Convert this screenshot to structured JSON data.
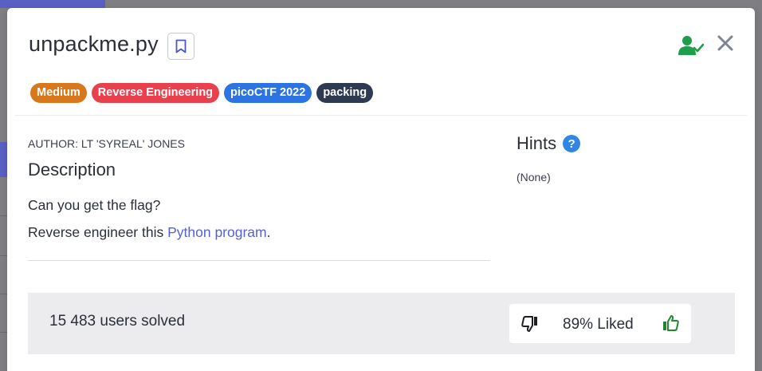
{
  "challenge": {
    "title": "unpackme.py",
    "tags": [
      {
        "label": "Medium",
        "color": "#d9771d"
      },
      {
        "label": "Reverse Engineering",
        "color": "#e8404c"
      },
      {
        "label": "picoCTF 2022",
        "color": "#2b74e2"
      },
      {
        "label": "packing",
        "color": "#2e3a52"
      }
    ],
    "author": "AUTHOR: LT 'SYREAL' JONES",
    "description_heading": "Description",
    "description_line1": "Can you get the flag?",
    "description_line2_prefix": "Reverse engineer this ",
    "description_link": "Python program",
    "description_line2_suffix": ".",
    "hints_heading": "Hints",
    "hints_help": "?",
    "hints_value": "(None)",
    "solved": "15 483 users solved",
    "liked": "89% Liked"
  },
  "icons": {
    "bookmark": "bookmark-icon",
    "solved_user": "user-check-icon",
    "close": "close-icon",
    "thumb_down": "thumbs-down-icon",
    "thumb_up": "thumbs-up-icon"
  },
  "colors": {
    "accent_link": "#5462d6",
    "solved_green": "#1e9e4a",
    "like_green": "#1e8a2e"
  }
}
